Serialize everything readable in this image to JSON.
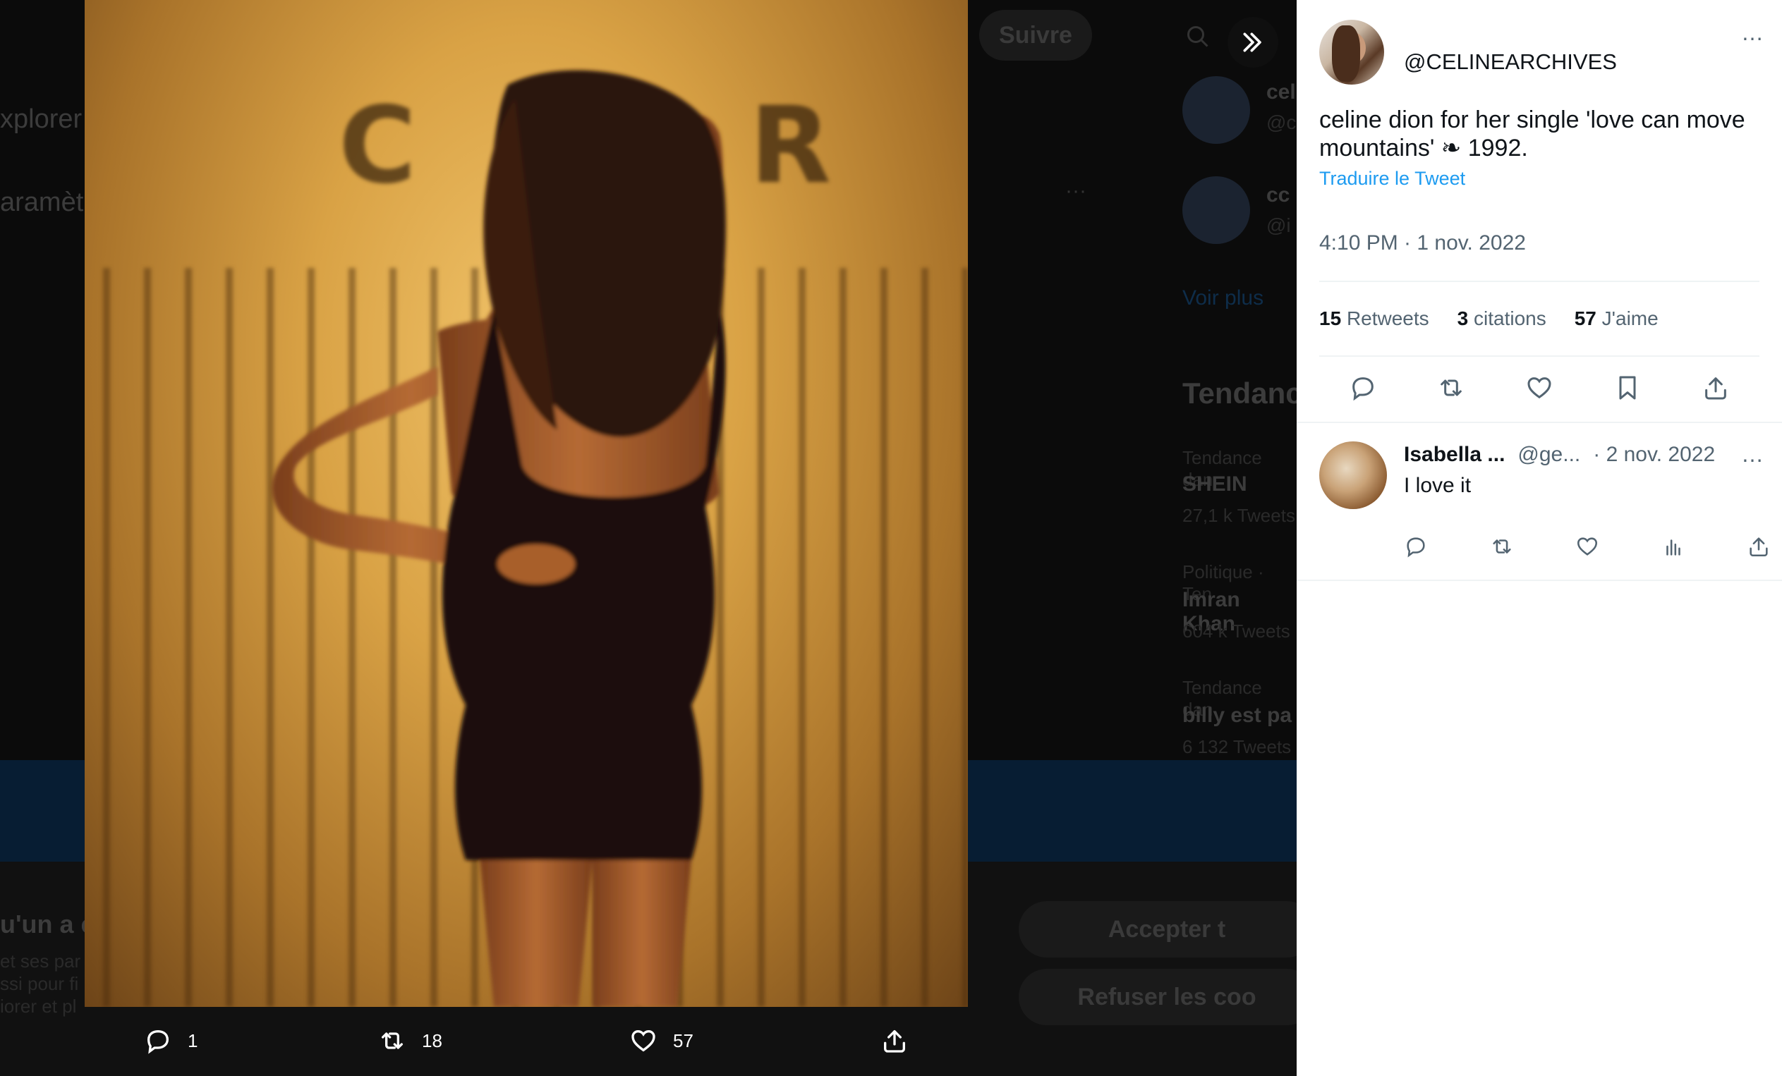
{
  "background": {
    "follow_button": "Suivre",
    "nav_explorer": "xplorer",
    "nav_parametres": "aramèt",
    "who_to_follow": [
      {
        "name": "cel",
        "handle": "@c"
      },
      {
        "name": "cc",
        "handle": "@i"
      }
    ],
    "show_more": "Voir plus",
    "trends_title": "Tendanc",
    "trends": [
      {
        "category": "Tendance dan",
        "title": "SHEIN",
        "count": "27,1 k Tweets"
      },
      {
        "category": "Politique · Ten",
        "title": "Imran Khan",
        "count": "604 k Tweets"
      },
      {
        "category": "Tendance dan",
        "title": "billy est pa",
        "count": "6 132 Tweets"
      }
    ],
    "cookie_title": "u'un a c",
    "cookie_lines": [
      "et ses par",
      "ssi pour fi",
      "iorer et pl"
    ],
    "accept_button": "Accepter t",
    "refuse_button": "Refuser les coo"
  },
  "photo_sign_text": "C EX R",
  "viewer_actions": {
    "reply_count": "1",
    "retweet_count": "18",
    "like_count": "57"
  },
  "tweet": {
    "handle": "@CELINEARCHIVES",
    "text_line1": "celine dion for her single 'love can move",
    "text_line2": "mountains' ❧ 1992.",
    "translate": "Traduire le Tweet",
    "timestamp": "4:10 PM · 1 nov. 2022",
    "stats": [
      {
        "count": "15",
        "label": "Retweets"
      },
      {
        "count": "3",
        "label": "citations"
      },
      {
        "count": "57",
        "label": "J'aime"
      }
    ],
    "more_icon": "…"
  },
  "reply": {
    "name": "Isabella ...",
    "handle": "@ge...",
    "date": "· 2 nov. 2022",
    "text": "I love it"
  }
}
